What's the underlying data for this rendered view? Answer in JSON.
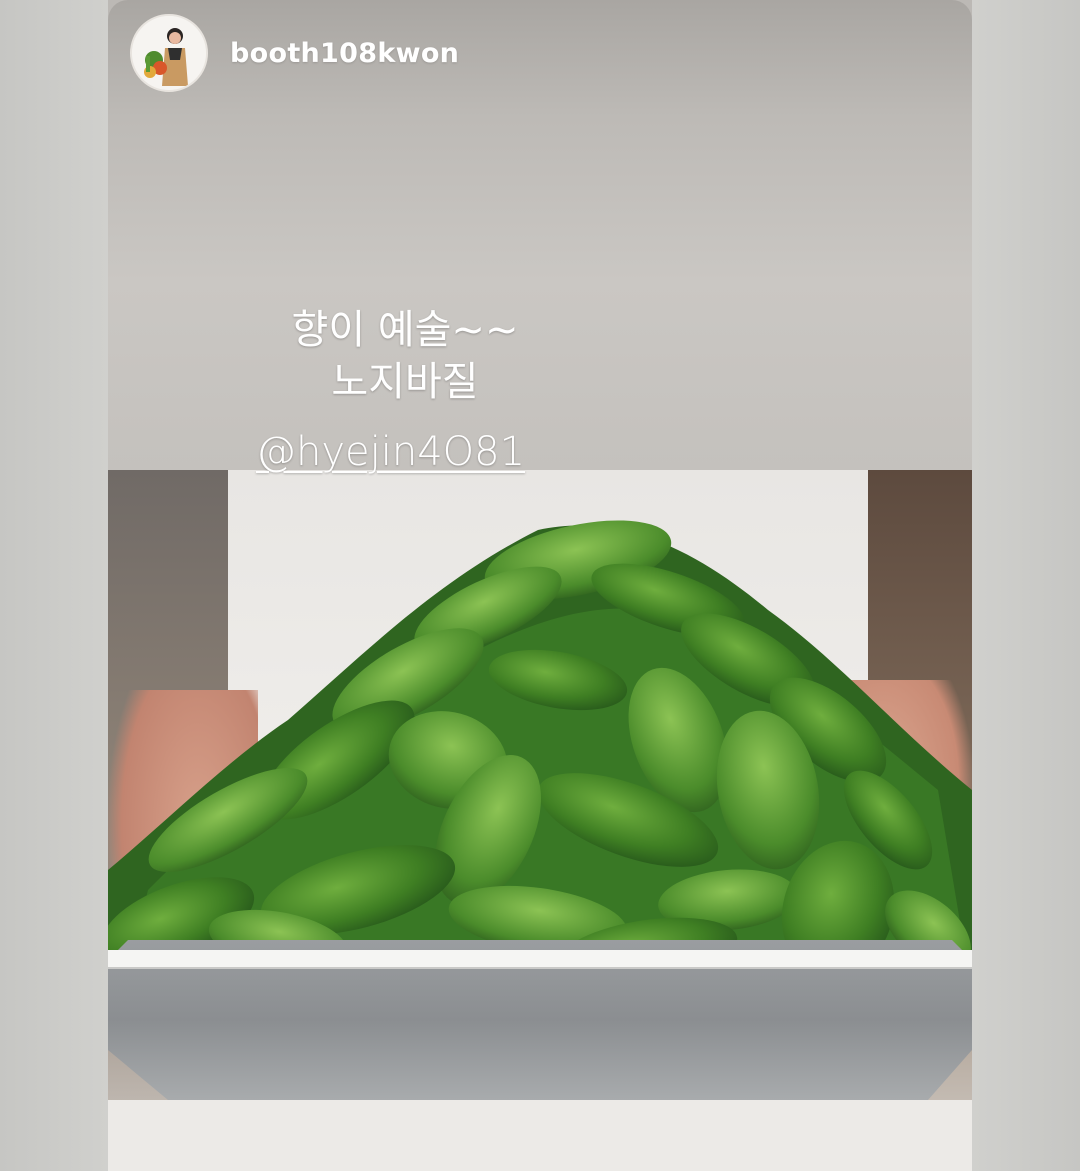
{
  "story": {
    "username": "booth108kwon",
    "caption_lines": [
      "향이 예술~~",
      "노지바질"
    ],
    "mention": "@hyejin4O81"
  },
  "icons": {
    "avatar": "profile-avatar-icon"
  }
}
